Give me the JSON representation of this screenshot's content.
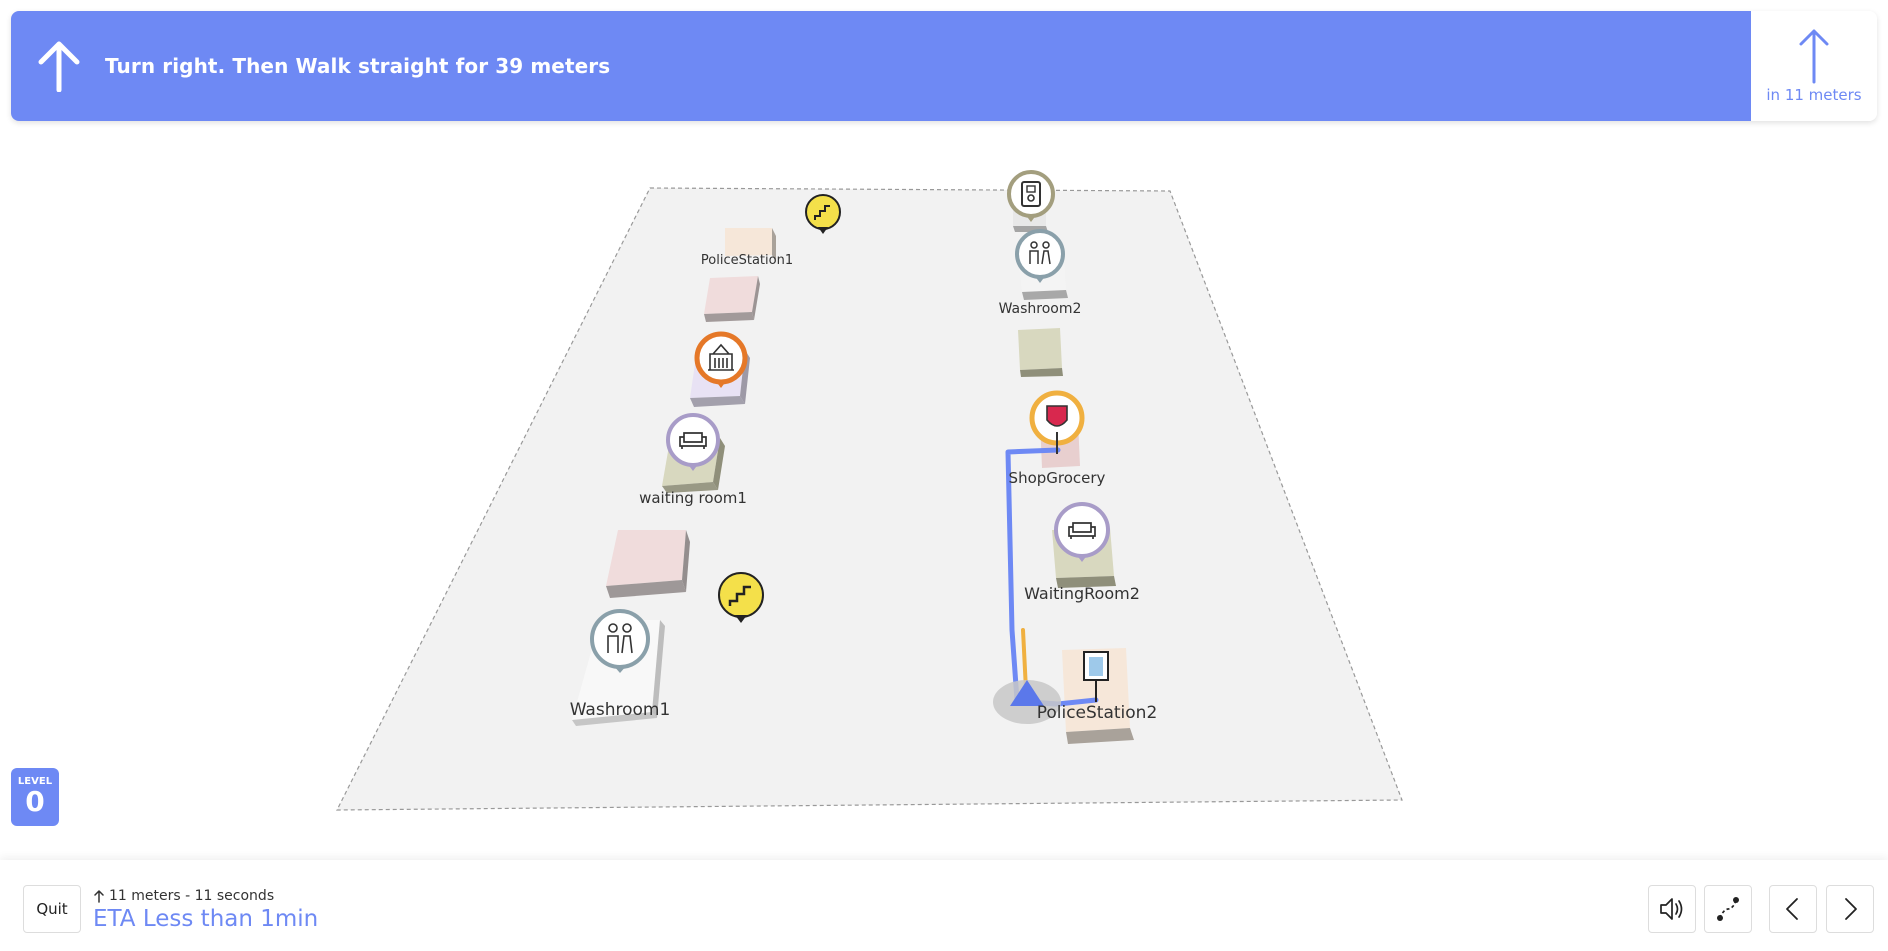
{
  "banner": {
    "instruction": "Turn right. Then Walk straight for 39 meters",
    "next_distance": "in 11 meters",
    "current_icon": "arrow-up-icon",
    "next_icon": "arrow-up-icon"
  },
  "colors": {
    "accent": "#6e89f4",
    "route": "#6e89f4",
    "route_progress": "#f0b040",
    "floor": "#f2f2f2"
  },
  "map": {
    "labels": {
      "police_station_1": "PoliceStation1",
      "washroom_2": "Washroom2",
      "waiting_room_1": "waiting room1",
      "shop_grocery": "ShopGrocery",
      "waiting_room_2": "WaitingRoom2",
      "washroom_1": "Washroom1",
      "police_station_2": "PoliceStation2"
    },
    "markers": [
      {
        "name": "stairs-marker",
        "icon": "stairs-icon"
      },
      {
        "name": "elevator-marker",
        "icon": "elevator-icon"
      },
      {
        "name": "washroom-marker",
        "icon": "restroom-icon"
      },
      {
        "name": "building-marker",
        "icon": "building-icon"
      },
      {
        "name": "waiting-room-marker",
        "icon": "sofa-icon"
      },
      {
        "name": "shop-grocery-marker",
        "icon": "shield-icon"
      },
      {
        "name": "destination-marker",
        "icon": "door-icon"
      }
    ]
  },
  "level": {
    "label": "LEVEL",
    "value": "0"
  },
  "bottom": {
    "quit_label": "Quit",
    "meta": "11 meters -  11 seconds",
    "eta": "ETA Less than 1min"
  },
  "controls": [
    {
      "name": "sound-button",
      "icon": "speaker-icon"
    },
    {
      "name": "route-overview-button",
      "icon": "route-icon"
    },
    {
      "name": "previous-step-button",
      "icon": "chevron-left-icon"
    },
    {
      "name": "next-step-button",
      "icon": "chevron-right-icon"
    }
  ]
}
